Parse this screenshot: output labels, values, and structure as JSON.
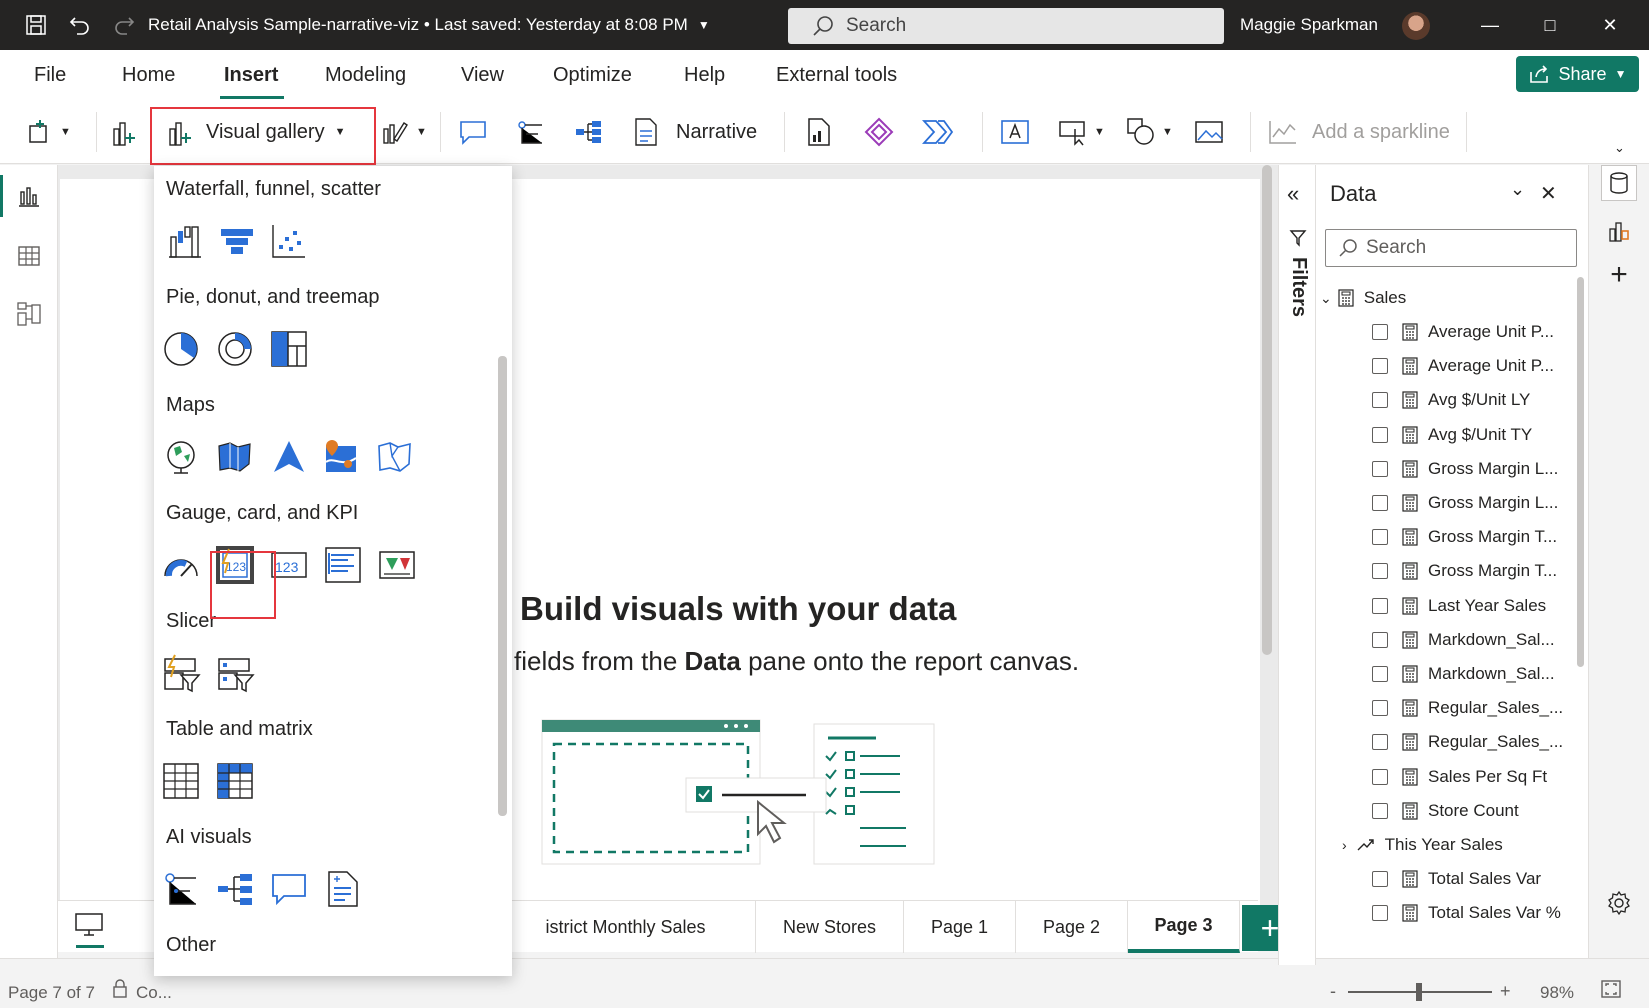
{
  "titlebar": {
    "title": "Retail Analysis Sample-narrative-viz • Last saved: Yesterday at 8:08 PM",
    "search": "Search",
    "user": "Maggie Sparkman"
  },
  "menu": {
    "items": [
      "File",
      "Home",
      "Insert",
      "Modeling",
      "View",
      "Optimize",
      "Help",
      "External tools"
    ],
    "active": "Insert",
    "share": "Share"
  },
  "ribbon": {
    "visual_gallery": "Visual gallery",
    "narrative": "Narrative",
    "sparkline": "Add a sparkline"
  },
  "gallery": {
    "sections": [
      "Waterfall, funnel, scatter",
      "Pie, donut, and treemap",
      "Maps",
      "Gauge, card, and KPI",
      "Slicer",
      "Table and matrix",
      "AI visuals",
      "Other"
    ]
  },
  "canvas": {
    "empty_title": "Build visuals with your data",
    "empty_sub_prefix": "fields from the ",
    "empty_sub_bold": "Data",
    "empty_sub_suffix": " pane onto the report canvas."
  },
  "pagetabs": [
    "istrict Monthly Sales",
    "New Stores",
    "Page 1",
    "Page 2",
    "Page 3"
  ],
  "pagetabs_active": "Page 3",
  "pagetabs_add": "+",
  "filters": {
    "label": "Filters"
  },
  "datapane": {
    "title": "Data",
    "search": "Search",
    "table": "Sales",
    "fields": [
      "Average Unit P...",
      "Average Unit P...",
      "Avg $/Unit LY",
      "Avg $/Unit TY",
      "Gross Margin L...",
      "Gross Margin L...",
      "Gross Margin T...",
      "Gross Margin T...",
      "Last Year Sales",
      "Markdown_Sal...",
      "Markdown_Sal...",
      "Regular_Sales_...",
      "Regular_Sales_...",
      "Sales Per Sq Ft",
      "Store Count",
      "This Year Sales",
      "Total Sales Var",
      "Total Sales Var %"
    ]
  },
  "status": {
    "page": "Page 7 of 7",
    "confidential": "Co...",
    "zoom": "98%",
    "minus": "-",
    "plus": "+"
  },
  "colors": {
    "accent": "#117865",
    "highlight": "#e5363d",
    "titlebar": "#252423"
  }
}
